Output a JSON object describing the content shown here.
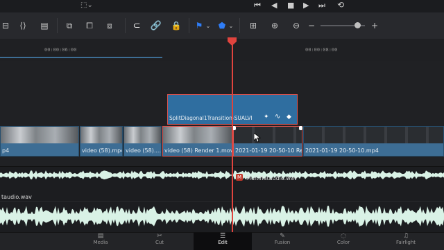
{
  "ruler": {
    "timecodes": [
      "00:00:06:00",
      "00:00:08:00"
    ]
  },
  "transition": {
    "label": "SplitDiagonal1Transition-SUALVI"
  },
  "video_clips": [
    {
      "label": "p4"
    },
    {
      "label": "video (58).mp4"
    },
    {
      "label": "video (58)...."
    },
    {
      "label": "video (58) Render 1.mov"
    },
    {
      "label": "2021-01-19 20-50-10 Re..."
    },
    {
      "label": "2021-01-19 20-50-10.mp4"
    }
  ],
  "audio": {
    "track1_left_label": "taudio.wav",
    "track1_right_label": "Multiflataudio.wav",
    "badge": "M"
  },
  "nav": {
    "items": [
      "Media",
      "Cut",
      "Edit",
      "Fusion",
      "Color",
      "Fairlight"
    ],
    "active": "Edit"
  },
  "colors": {
    "accent": "#e0443e",
    "clip": "#3d6d94",
    "wave": "#d9f2e6",
    "flag": "#2f7df6"
  }
}
